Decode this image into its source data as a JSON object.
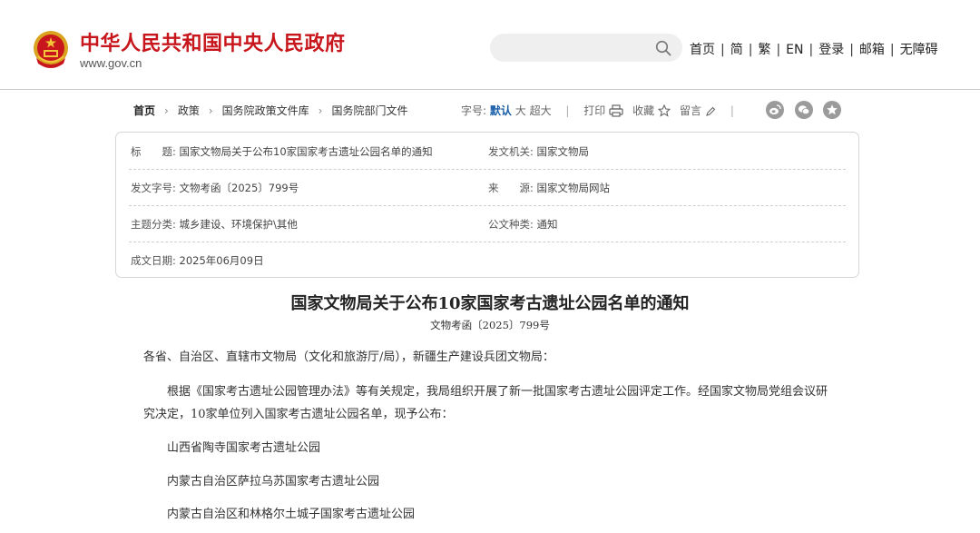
{
  "header": {
    "site_title": "中华人民共和国中央人民政府",
    "site_url": "www.gov.cn",
    "search_placeholder": "",
    "nav": [
      "首页",
      "简",
      "繁",
      "EN",
      "登录",
      "邮箱",
      "无障碍"
    ]
  },
  "breadcrumb": [
    "首页",
    "政策",
    "国务院政策文件库",
    "国务院部门文件"
  ],
  "toolbar": {
    "font_label": "字号:",
    "font_default": "默认",
    "font_large": "大",
    "font_xlarge": "超大",
    "print": "打印",
    "favorite": "收藏",
    "comment": "留言"
  },
  "meta": {
    "title_label": "标　　题:",
    "title_value": "国家文物局关于公布10家国家考古遗址公园名单的通知",
    "issuer_label": "发文机关:",
    "issuer_value": "国家文物局",
    "doc_no_label": "发文字号:",
    "doc_no_value": "文物考函〔2025〕799号",
    "source_label": "来　　源:",
    "source_value": "国家文物局网站",
    "category_label": "主题分类:",
    "category_value": "城乡建设、环境保护\\其他",
    "type_label": "公文种类:",
    "type_value": "通知",
    "date_label": "成文日期:",
    "date_value": "2025年06月09日"
  },
  "article": {
    "title": "国家文物局关于公布10家国家考古遗址公园名单的通知",
    "doc_no": "文物考函〔2025〕799号",
    "salutation": "各省、自治区、直辖市文物局（文化和旅游厅/局），新疆生产建设兵团文物局：",
    "body_line1": "根据《国家考古遗址公园管理办法》等有关规定，我局组织开展了新一批国家考古遗址公园评定工作。经国家文物局党组会议研",
    "body_line2": "究决定，10家单位列入国家考古遗址公园名单，现予公布：",
    "items": [
      "山西省陶寺国家考古遗址公园",
      "内蒙古自治区萨拉乌苏国家考古遗址公园",
      "内蒙古自治区和林格尔土城子国家考古遗址公园"
    ]
  },
  "colors": {
    "brand_red": "#c8161d",
    "link_blue": "#1a5fa8",
    "share_gray": "#9b9b9b"
  },
  "icons": [
    "national-emblem",
    "search-icon",
    "print-icon",
    "star-icon",
    "pencil-icon",
    "weibo-icon",
    "wechat-icon",
    "favorite-star-icon"
  ]
}
